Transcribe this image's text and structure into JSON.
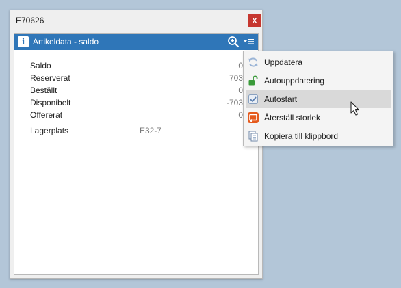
{
  "window": {
    "title": "E70626",
    "close_label": "x"
  },
  "panel": {
    "title": "Artikeldata - saldo",
    "info_icon_glyph": "i",
    "header_color": "#2f76b8"
  },
  "rows": [
    {
      "label": "Saldo",
      "value": "0"
    },
    {
      "label": "Reserverat",
      "value": "703"
    },
    {
      "label": "Beställt",
      "value": "0"
    },
    {
      "label": "Disponibelt",
      "value": "-703"
    },
    {
      "label": "Offererat",
      "value": "0"
    }
  ],
  "location": {
    "label": "Lagerplats",
    "value": "E32-7"
  },
  "menu": {
    "items": [
      {
        "label": "Uppdatera",
        "icon": "refresh-icon"
      },
      {
        "label": "Autouppdatering",
        "icon": "unlock-icon"
      },
      {
        "label": "Autostart",
        "icon": "checkbox-checked-icon"
      },
      {
        "label": "Återställ storlek",
        "icon": "reset-size-icon"
      },
      {
        "label": "Kopiera till klippbord",
        "icon": "clipboard-icon"
      }
    ],
    "hovered_index": 2
  }
}
